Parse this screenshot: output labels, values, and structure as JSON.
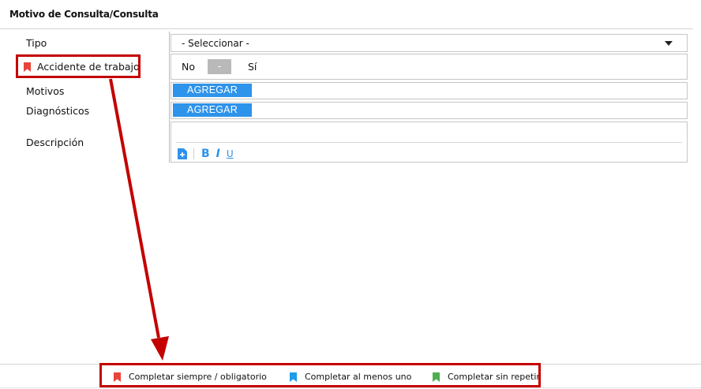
{
  "header": {
    "title": "Motivo de Consulta/Consulta"
  },
  "form": {
    "tipo": {
      "label": "Tipo",
      "selected": "- Seleccionar -"
    },
    "accidente": {
      "label": "Accidente de trabajo",
      "no": "No",
      "toggle": "-",
      "si": "Sí",
      "marker_color": "#e8453c"
    },
    "motivos": {
      "label": "Motivos",
      "button": "AGREGAR"
    },
    "diagnosticos": {
      "label": "Diagnósticos",
      "button": "AGREGAR"
    },
    "descripcion": {
      "label": "Descripción",
      "toolbar": {
        "bold": "B",
        "italic": "I",
        "underline": "U"
      }
    }
  },
  "legend": {
    "items": [
      {
        "label": "Completar siempre / obligatorio",
        "color": "#e8453c"
      },
      {
        "label": "Completar al menos uno",
        "color": "#1e9be9"
      },
      {
        "label": "Completar sin repetir",
        "color": "#4caf50"
      }
    ]
  },
  "colors": {
    "accent": "#2e93ea",
    "highlight": "#c40000"
  }
}
